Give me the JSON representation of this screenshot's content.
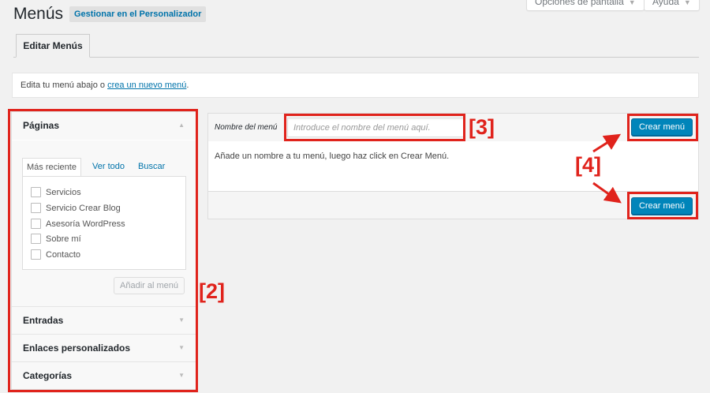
{
  "screen_options": {
    "label": "Opciones de pantalla",
    "help_label": "Ayuda"
  },
  "header": {
    "title": "Menús",
    "customize_link": "Gestionar en el Personalizador"
  },
  "tabs": [
    {
      "label": "Editar Menús"
    }
  ],
  "notice": {
    "prefix": "Edita tu menú abajo o ",
    "link": "crea un nuevo menú",
    "suffix": "."
  },
  "accordion": {
    "pages": {
      "title": "Páginas",
      "tabs": [
        "Más reciente",
        "Ver todo",
        "Buscar"
      ],
      "items": [
        "Servicios",
        "Servicio Crear Blog",
        "Asesoría WordPress",
        "Sobre mí",
        "Contacto"
      ],
      "add_button": "Añadir al menú"
    },
    "sections": [
      "Entradas",
      "Enlaces personalizados",
      "Categorías"
    ]
  },
  "editor": {
    "name_label": "Nombre del menú",
    "name_placeholder": "Introduce el nombre del menú aquí.",
    "instruction": "Añade un nombre a tu menú, luego haz click en Crear Menú.",
    "create_button_top": "Crear menú",
    "create_button_bottom": "Crear menú"
  },
  "annotations": {
    "label_2": "[2]",
    "label_3": "[3]",
    "label_4": "[4]",
    "color": "#e0231c"
  },
  "colors": {
    "primary_button": "#0085ba",
    "link": "#0073aa",
    "background": "#f1f1f1"
  }
}
